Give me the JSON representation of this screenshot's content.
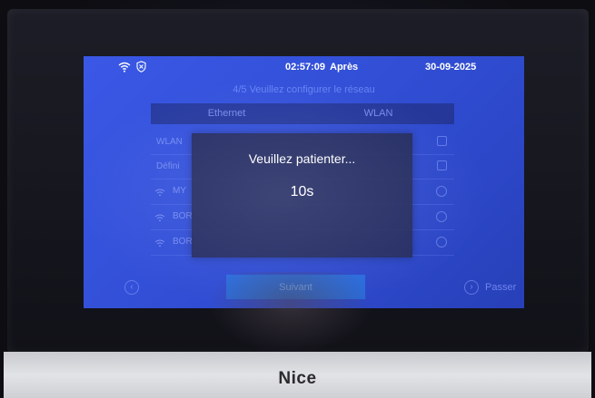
{
  "status_bar": {
    "wifi_icon": "wifi-icon",
    "shield_icon": "shield-icon",
    "time": "02:57:09",
    "ampm": "Après",
    "date": "30-09-2025"
  },
  "page": {
    "title": "4/5 Veuillez configurer le réseau"
  },
  "tabs": [
    {
      "label": "Ethernet"
    },
    {
      "label": "WLAN"
    }
  ],
  "rows": [
    {
      "label": "WLAN"
    },
    {
      "label": "Défini"
    },
    {
      "label": "MY"
    },
    {
      "label": "BOR"
    },
    {
      "label": "BOR"
    }
  ],
  "footer": {
    "next_label": "Suivant",
    "skip_label": "Passer",
    "back_icon": "chevron-left-icon",
    "skip_icon": "chevron-right-icon"
  },
  "modal": {
    "title": "Veuillez patienter...",
    "countdown": "10s"
  },
  "device": {
    "brand": "Nice"
  },
  "colors": {
    "screen_blue": "#3350d8",
    "modal_bg": "#262c5c"
  }
}
